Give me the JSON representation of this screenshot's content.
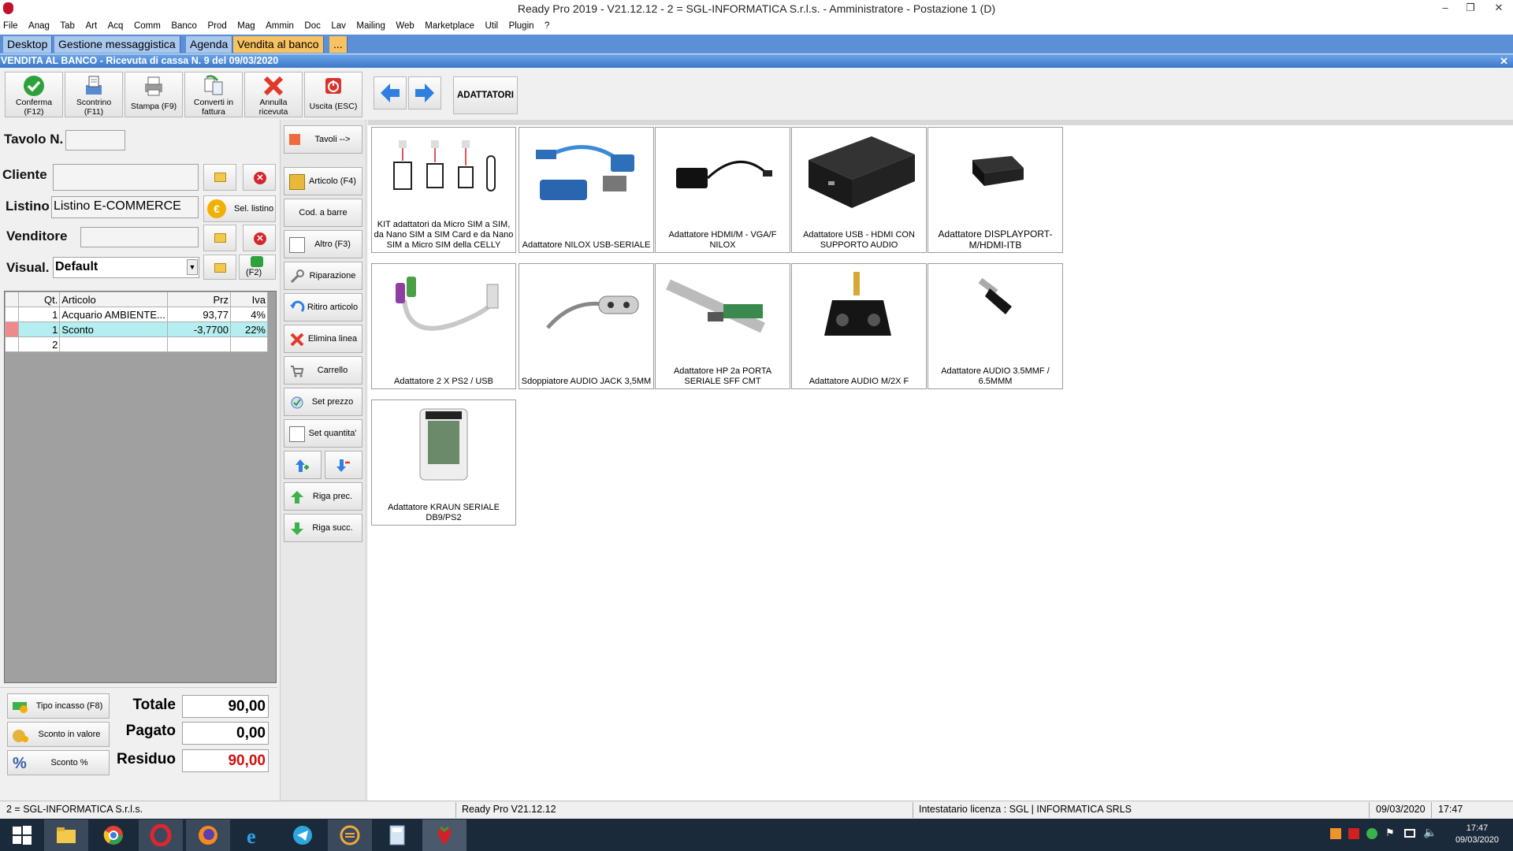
{
  "window": {
    "title": "Ready Pro 2019 - V21.12.12 - 2 = SGL-INFORMATICA S.r.l.s. - Amministratore - Postazione 1 (D)"
  },
  "menu": [
    "File",
    "Anag",
    "Tab",
    "Art",
    "Acq",
    "Comm",
    "Banco",
    "Prod",
    "Mag",
    "Ammin",
    "Doc",
    "Lav",
    "Mailing",
    "Web",
    "Marketplace",
    "Util",
    "Plugin",
    "?"
  ],
  "tabs": [
    "Desktop",
    "Gestione messaggistica",
    "Agenda",
    "Vendita al banco",
    "..."
  ],
  "section_title": "VENDITA AL BANCO - Ricevuta di cassa N. 9 del 09/03/2020",
  "toolbar": {
    "conferma": "Conferma",
    "conferma_key": "(F12)",
    "scontrino": "Scontrino",
    "scontrino_key": "(F11)",
    "stampa": "Stampa (F9)",
    "converti": "Converti in",
    "converti2": "fattura",
    "annulla": "Annulla",
    "annulla2": "ricevuta",
    "uscita": "Uscita (ESC)",
    "category": "ADATTATORI"
  },
  "form": {
    "tavolo_label": "Tavolo N.",
    "tavolo_value": "",
    "tavoli_btn": "Tavoli -->",
    "cliente_label": "Cliente",
    "cliente_value": "",
    "listino_label": "Listino",
    "listino_value": "Listino E-COMMERCE",
    "sel_listino": "Sel. listino",
    "venditore_label": "Venditore",
    "venditore_value": "",
    "visual_label": "Visual.",
    "visual_value": "Default",
    "f2": "(F2)"
  },
  "grid": {
    "headers": [
      "Qt.",
      "Articolo",
      "Prz",
      "Iva"
    ],
    "rows": [
      {
        "qt": "1",
        "articolo": "Acquario AMBIENTE...",
        "prz": "93,77",
        "iva": "4%"
      },
      {
        "qt": "1",
        "articolo": "Sconto",
        "prz": "-3,7700",
        "iva": "22%"
      },
      {
        "qt": "2",
        "articolo": "",
        "prz": "",
        "iva": ""
      }
    ]
  },
  "side_buttons": {
    "articolo": "Articolo (F4)",
    "barre": "Cod. a barre",
    "altro": "Altro (F3)",
    "riparazione": "Riparazione",
    "ritiro": "Ritiro articolo",
    "elimina": "Elimina linea",
    "carrello": "Carrello",
    "setprezzo": "Set prezzo",
    "setquantita": "Set quantita'",
    "rigaprec": "Riga prec.",
    "rigasucc": "Riga succ."
  },
  "totals": {
    "tipo_incasso": "Tipo incasso (F8)",
    "sconto_valore": "Sconto in valore",
    "sconto_perc": "Sconto %",
    "totale_label": "Totale",
    "totale": "90,00",
    "pagato_label": "Pagato",
    "pagato": "0,00",
    "residuo_label": "Residuo",
    "residuo": "90,00"
  },
  "products": [
    {
      "name": "KIT adattatori da Micro SIM a SIM, da Nano SIM a SIM Card e da Nano SIM a Micro SIM della CELLY"
    },
    {
      "name": "Adattatore NILOX USB-SERIALE"
    },
    {
      "name": "Adattatore  HDMI/M - VGA/F NILOX"
    },
    {
      "name": "Adattatore USB - HDMI CON SUPPORTO AUDIO"
    },
    {
      "name": "Adattatore DISPLAYPORT-M/HDMI-ITB"
    },
    {
      "name": "Adattatore 2 X PS2 / USB"
    },
    {
      "name": "Sdoppiatore AUDIO JACK 3,5MM"
    },
    {
      "name": "Adattatore HP 2a PORTA SERIALE SFF CMT"
    },
    {
      "name": "Adattatore AUDIO M/2X F"
    },
    {
      "name": "Adattatore AUDIO 3.5MMF / 6.5MMM"
    },
    {
      "name": "Adattatore KRAUN SERIALE DB9/PS2"
    }
  ],
  "status": {
    "company": "2 = SGL-INFORMATICA S.r.l.s.",
    "version": "Ready Pro V21.12.12",
    "licenza": "Intestatario licenza : SGL | INFORMATICA SRLS",
    "date": "09/03/2020",
    "time": "17:47"
  },
  "taskbar": {
    "time": "17:47",
    "date": "09/03/2020"
  },
  "colors": {
    "tab_active": "#f8c261",
    "tabbar": "#5b8fd6",
    "residuo": "#d01010",
    "selected_row": "#b4eef0"
  }
}
